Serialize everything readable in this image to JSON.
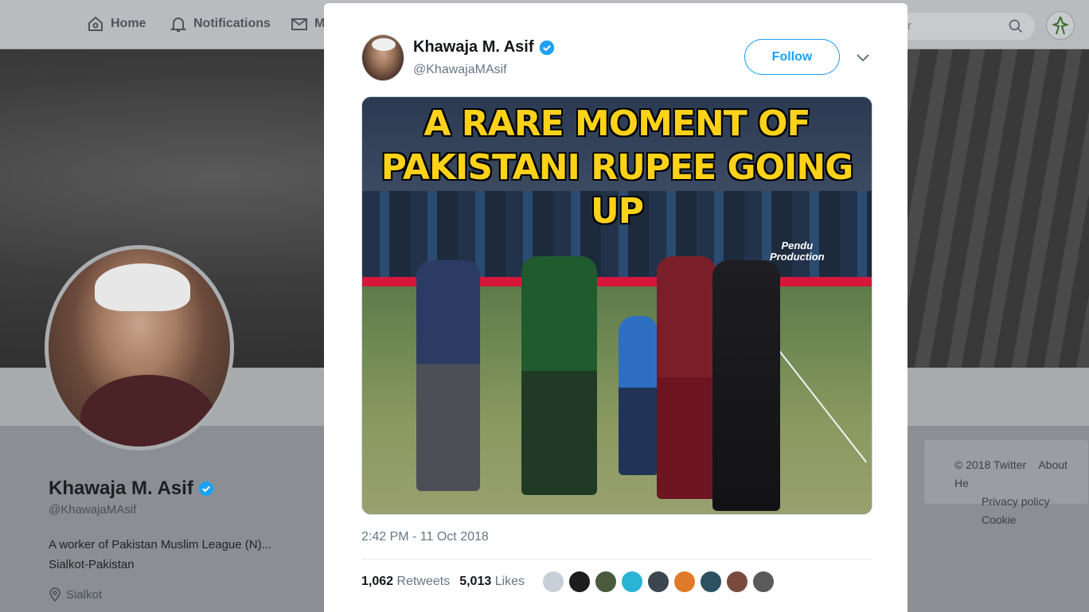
{
  "nav": {
    "home": "Home",
    "notifications": "Notifications",
    "messages_partial": "M",
    "search_placeholder_partial": "r"
  },
  "profile": {
    "name": "Khawaja M. Asif",
    "handle": "@KhawajaMAsif",
    "bio_line1": "A worker of Pakistan Muslim League (N)...",
    "bio_line2": "Sialkot-Pakistan",
    "location": "Sialkot"
  },
  "footer": {
    "copyright": "© 2018 Twitter",
    "about": "About",
    "help_partial": "He",
    "privacy": "Privacy policy",
    "cookies_partial": "Cookie"
  },
  "tweet": {
    "author_name": "Khawaja M. Asif",
    "author_handle": "@KhawajaMAsif",
    "follow_label": "Follow",
    "media_headline_line1": "A RARE MOMENT OF",
    "media_headline_line2": "PAKISTANI RUPEE GOING UP",
    "media_watermark_line1": "Pendu",
    "media_watermark_line2": "Production",
    "timestamp": "2:42 PM - 11 Oct 2018",
    "retweets_count": "1,062",
    "retweets_label": "Retweets",
    "likes_count": "5,013",
    "likes_label": "Likes"
  },
  "colors": {
    "accent": "#1da1f2",
    "headline": "#ffd21a"
  }
}
